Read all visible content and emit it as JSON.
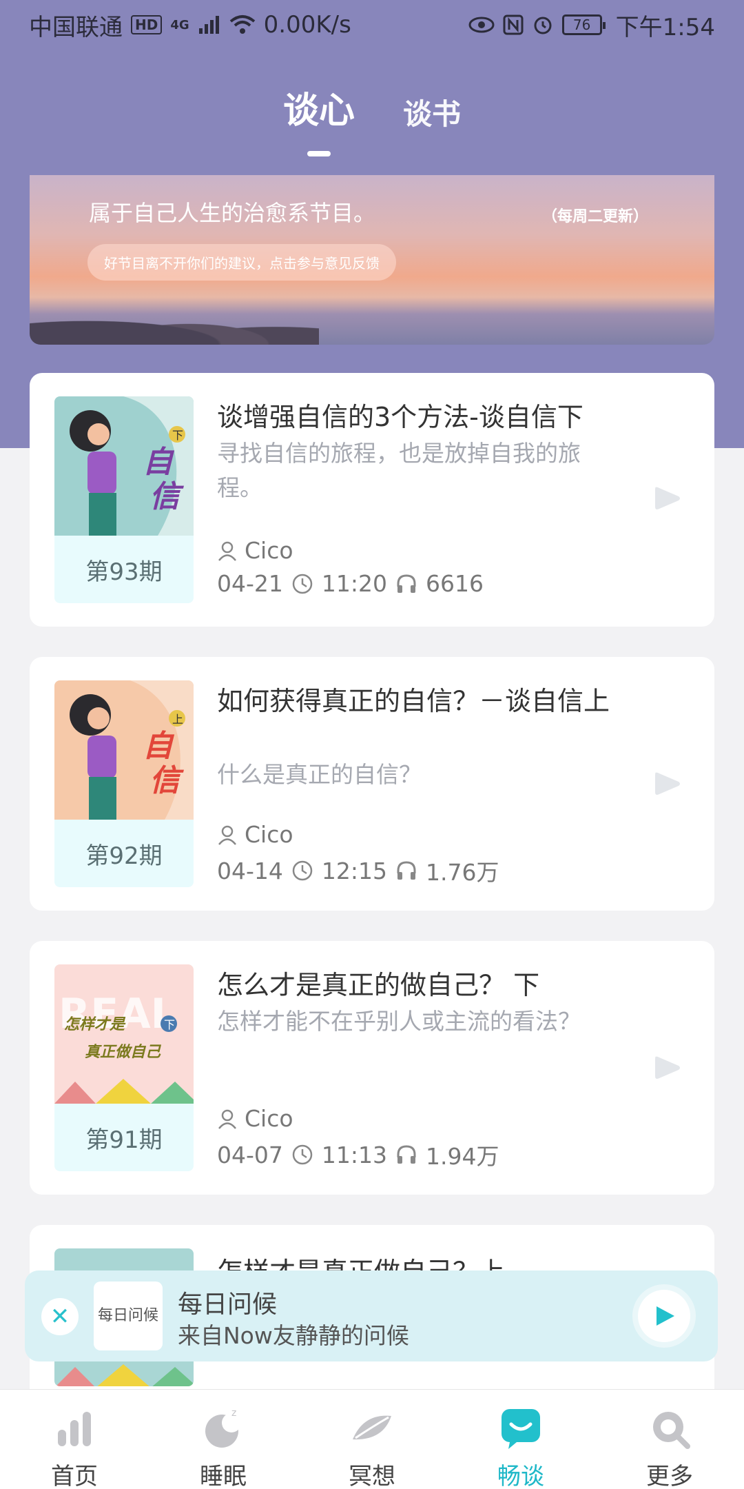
{
  "status_bar": {
    "carrier": "中国联通",
    "hd": "HD",
    "net": "4G",
    "speed": "0.00K/s",
    "battery": "76",
    "time": "下午1:54"
  },
  "tabs": [
    {
      "label": "谈心",
      "active": true
    },
    {
      "label": "谈书",
      "active": false
    }
  ],
  "banner": {
    "text": "属于自己人生的治愈系节目。",
    "note": "（每周二更新）",
    "feedback": "好节目离不开你们的建议，点击参与意见反馈"
  },
  "episodes": [
    {
      "issue": "第93期",
      "title": "谈增强自信的3个方法-谈自信下",
      "desc": "寻找自信的旅程，也是放掉自我的旅程。",
      "author": "Cico",
      "date": "04-21",
      "duration": "11:20",
      "plays": "6616",
      "cover_word": "自信",
      "cover_tag": "下"
    },
    {
      "issue": "第92期",
      "title": "如何获得真正的自信？－谈自信上",
      "desc": "什么是真正的自信？",
      "author": "Cico",
      "date": "04-14",
      "duration": "12:15",
      "plays": "1.76万",
      "cover_word": "自信",
      "cover_tag": "上"
    },
    {
      "issue": "第91期",
      "title": "怎么才是真正的做自己？ 下",
      "desc": "怎样才能不在乎别人或主流的看法？",
      "author": "Cico",
      "date": "04-07",
      "duration": "11:13",
      "plays": "1.94万",
      "cover_word_1": "怎样才是",
      "cover_word_2": "真正做自己",
      "cover_tag": "下"
    },
    {
      "title": "怎样才是真正做自己？上"
    }
  ],
  "mini_player": {
    "thumb_text": "每日问候",
    "title": "每日问候",
    "subtitle": "来自Now友静静的问候"
  },
  "bottom_nav": [
    {
      "label": "首页",
      "icon": "bar-chart-icon"
    },
    {
      "label": "睡眠",
      "icon": "moon-icon"
    },
    {
      "label": "冥想",
      "icon": "feather-icon"
    },
    {
      "label": "畅谈",
      "icon": "chat-icon",
      "active": true
    },
    {
      "label": "更多",
      "icon": "search-icon"
    }
  ],
  "colors": {
    "header": "#8886bb",
    "accent": "#1fb8c8",
    "cover_bg": "#e8fbfd"
  }
}
